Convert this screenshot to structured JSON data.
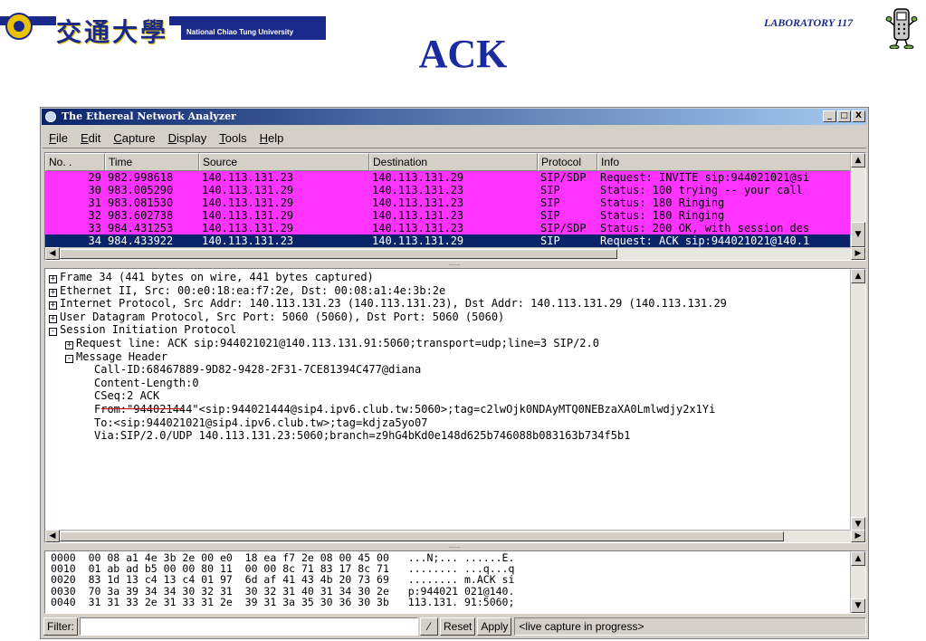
{
  "slide": {
    "university_chars": [
      "交",
      "通",
      "大",
      "學"
    ],
    "university_en": "National Chiao Tung University",
    "lab_label": "LABORATORY 117",
    "title": "ACK"
  },
  "window": {
    "title": "The Ethereal Network Analyzer",
    "buttons": [
      "_",
      "□",
      "X"
    ]
  },
  "menu": [
    {
      "underline": "F",
      "rest": "ile"
    },
    {
      "underline": "E",
      "rest": "dit"
    },
    {
      "underline": "C",
      "rest": "apture"
    },
    {
      "underline": "D",
      "rest": "isplay"
    },
    {
      "underline": "T",
      "rest": "ools"
    },
    {
      "underline": "H",
      "rest": "elp"
    }
  ],
  "packet_list": {
    "columns": [
      "No. .",
      "Time",
      "Source",
      "Destination",
      "Protocol",
      "Info"
    ],
    "rows": [
      {
        "no": "29",
        "time": "982.998618",
        "src": "140.113.131.23",
        "dst": "140.113.131.29",
        "proto": "SIP/SDP",
        "info": "Request: INVITE sip:944021021@si",
        "bg": "#ff33ff",
        "fg": "#000000"
      },
      {
        "no": "30",
        "time": "983.005290",
        "src": "140.113.131.29",
        "dst": "140.113.131.23",
        "proto": "SIP",
        "info": "Status: 100 trying -- your call",
        "bg": "#ff33ff",
        "fg": "#000000"
      },
      {
        "no": "31",
        "time": "983.081530",
        "src": "140.113.131.29",
        "dst": "140.113.131.23",
        "proto": "SIP",
        "info": "Status: 180 Ringing",
        "bg": "#ff33ff",
        "fg": "#000000"
      },
      {
        "no": "32",
        "time": "983.602738",
        "src": "140.113.131.29",
        "dst": "140.113.131.23",
        "proto": "SIP",
        "info": "Status: 180 Ringing",
        "bg": "#ff33ff",
        "fg": "#000000"
      },
      {
        "no": "33",
        "time": "984.431253",
        "src": "140.113.131.29",
        "dst": "140.113.131.23",
        "proto": "SIP/SDP",
        "info": "Status: 200 OK, with session des",
        "bg": "#ff33ff",
        "fg": "#000000"
      },
      {
        "no": "34",
        "time": "984.433922",
        "src": "140.113.131.23",
        "dst": "140.113.131.29",
        "proto": "SIP",
        "info": "Request: ACK sip:944021021@140.1",
        "bg": "#0a246a",
        "fg": "#ffffff"
      }
    ]
  },
  "details": [
    {
      "indent": 0,
      "sign": "+",
      "text": "Frame 34 (441 bytes on wire, 441 bytes captured)"
    },
    {
      "indent": 0,
      "sign": "+",
      "text": "Ethernet II, Src: 00:e0:18:ea:f7:2e, Dst: 00:08:a1:4e:3b:2e"
    },
    {
      "indent": 0,
      "sign": "+",
      "text": "Internet Protocol, Src Addr: 140.113.131.23 (140.113.131.23), Dst Addr: 140.113.131.29 (140.113.131.29"
    },
    {
      "indent": 0,
      "sign": "+",
      "text": "User Datagram Protocol, Src Port: 5060 (5060), Dst Port: 5060 (5060)"
    },
    {
      "indent": 0,
      "sign": "-",
      "text": "Session Initiation Protocol"
    },
    {
      "indent": 1,
      "sign": "+",
      "text": "Request line: ACK sip:944021021@140.113.131.91:5060;transport=udp;line=3 SIP/2.0"
    },
    {
      "indent": 1,
      "sign": "-",
      "text": "Message Header"
    },
    {
      "indent": 2,
      "sign": "",
      "text": "Call-ID:68467889-9D82-9428-2F31-7CE81394C477@diana"
    },
    {
      "indent": 2,
      "sign": "",
      "text": "Content-Length:0"
    },
    {
      "indent": 2,
      "sign": "",
      "text": "CSeq:2 ACK",
      "underline": true
    },
    {
      "indent": 2,
      "sign": "",
      "text": "From:\"944021444\"<sip:944021444@sip4.ipv6.club.tw:5060>;tag=c2lwOjk0NDAyMTQ0NEBzaXA0Lmlwdjy2x1Yi"
    },
    {
      "indent": 2,
      "sign": "",
      "text": "To:<sip:944021021@sip4.ipv6.club.tw>;tag=kdjza5yo07"
    },
    {
      "indent": 2,
      "sign": "",
      "text": "Via:SIP/2.0/UDP  140.113.131.23:5060;branch=z9hG4bKd0e148d625b746088b083163b734f5b1"
    }
  ],
  "hex": [
    {
      "offset": "0000",
      "bytes": "00 08 a1 4e 3b 2e 00 e0  18 ea f7 2e 08 00 45 00",
      "ascii": "...N;... ......E."
    },
    {
      "offset": "0010",
      "bytes": "01 ab ad b5 00 00 80 11  00 00 8c 71 83 17 8c 71",
      "ascii": "........ ...q...q"
    },
    {
      "offset": "0020",
      "bytes": "83 1d 13 c4 13 c4 01 97  6d af 41 43 4b 20 73 69",
      "ascii": "........ m.ACK si"
    },
    {
      "offset": "0030",
      "bytes": "70 3a 39 34 34 30 32 31  30 32 31 40 31 34 30 2e",
      "ascii": "p:944021 021@140."
    },
    {
      "offset": "0040",
      "bytes": "31 31 33 2e 31 33 31 2e  39 31 3a 35 30 36 30 3b",
      "ascii": "113.131. 91:5060;"
    }
  ],
  "filter": {
    "label": "Filter:",
    "value": "",
    "clear_glyph": "⁄",
    "reset": "Reset",
    "apply": "Apply",
    "status": "<live capture in progress>"
  },
  "colors": {
    "sip_row": "#ff33ff",
    "selected_row": "#0a246a",
    "title_blue": "#1a2aa0",
    "cseq_underline": "#cc0000"
  }
}
